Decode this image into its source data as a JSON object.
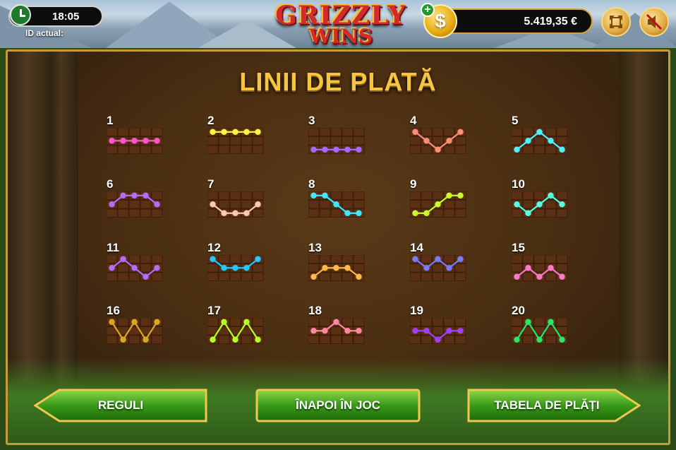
{
  "header": {
    "time": "18:05",
    "id_label": "ID actual:",
    "logo_line1": "GRIZZLY",
    "logo_line2": "WINS",
    "balance": "5.419,35 €",
    "coin_symbol": "$",
    "add_symbol": "+"
  },
  "panel": {
    "title": "LINII DE PLATĂ"
  },
  "paylines": [
    {
      "number": "1",
      "color": "#ff55c8",
      "rows": [
        1,
        1,
        1,
        1,
        1
      ]
    },
    {
      "number": "2",
      "color": "#fff44a",
      "rows": [
        0,
        0,
        0,
        0,
        0
      ]
    },
    {
      "number": "3",
      "color": "#a56bff",
      "rows": [
        2,
        2,
        2,
        2,
        2
      ]
    },
    {
      "number": "4",
      "color": "#ff8c78",
      "rows": [
        0,
        1,
        2,
        1,
        0
      ]
    },
    {
      "number": "5",
      "color": "#4ff0ff",
      "rows": [
        2,
        1,
        0,
        1,
        2
      ]
    },
    {
      "number": "6",
      "color": "#b56bff",
      "rows": [
        1,
        0,
        0,
        0,
        1
      ]
    },
    {
      "number": "7",
      "color": "#ffc9b0",
      "rows": [
        1,
        2,
        2,
        2,
        1
      ]
    },
    {
      "number": "8",
      "color": "#3ee8ff",
      "rows": [
        0,
        0,
        1,
        2,
        2
      ]
    },
    {
      "number": "9",
      "color": "#c8ff2a",
      "rows": [
        2,
        2,
        1,
        0,
        0
      ]
    },
    {
      "number": "10",
      "color": "#55ffe0",
      "rows": [
        1,
        2,
        1,
        0,
        1
      ]
    },
    {
      "number": "11",
      "color": "#b56bff",
      "rows": [
        1,
        0,
        1,
        2,
        1
      ]
    },
    {
      "number": "12",
      "color": "#22c8ff",
      "rows": [
        0,
        1,
        1,
        1,
        0
      ]
    },
    {
      "number": "13",
      "color": "#ffb84a",
      "rows": [
        2,
        1,
        1,
        1,
        2
      ]
    },
    {
      "number": "14",
      "color": "#7a7aff",
      "rows": [
        0,
        1,
        0,
        1,
        0
      ]
    },
    {
      "number": "15",
      "color": "#ff77c8",
      "rows": [
        2,
        1,
        2,
        1,
        2
      ]
    },
    {
      "number": "16",
      "color": "#d8a820",
      "rows": [
        0,
        2,
        0,
        2,
        0
      ]
    },
    {
      "number": "17",
      "color": "#b6ff2a",
      "rows": [
        2,
        0,
        2,
        0,
        2
      ]
    },
    {
      "number": "18",
      "color": "#ff88a0",
      "rows": [
        1,
        1,
        0,
        1,
        1
      ]
    },
    {
      "number": "19",
      "color": "#a040ff",
      "rows": [
        1,
        1,
        2,
        1,
        1
      ]
    },
    {
      "number": "20",
      "color": "#22e866",
      "rows": [
        2,
        0,
        2,
        0,
        2
      ]
    }
  ],
  "buttons": {
    "rules": "REGULI",
    "back": "ÎNAPOI ÎN JOC",
    "paytable": "TABELA DE PLĂȚI"
  },
  "colors": {
    "gold": "#f6c542",
    "button_green": "#3a9a18",
    "frame": "#c79a3a"
  }
}
